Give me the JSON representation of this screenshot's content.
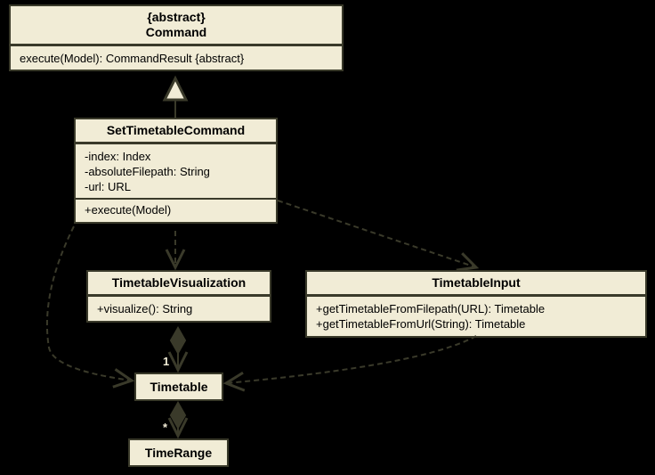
{
  "classes": {
    "command": {
      "stereotype": "{abstract}",
      "name": "Command",
      "method": "execute(Model): CommandResult {abstract}"
    },
    "setTimetableCommand": {
      "name": "SetTimetableCommand",
      "attr1": "-index: Index",
      "attr2": "-absoluteFilepath: String",
      "attr3": "-url: URL",
      "method": "+execute(Model)"
    },
    "timetableVisualization": {
      "name": "TimetableVisualization",
      "method": "+visualize(): String"
    },
    "timetableInput": {
      "name": "TimetableInput",
      "method1": "+getTimetableFromFilepath(URL): Timetable",
      "method2": "+getTimetableFromUrl(String): Timetable"
    },
    "timetable": {
      "name": "Timetable"
    },
    "timeRange": {
      "name": "TimeRange"
    }
  },
  "multiplicities": {
    "one": "1",
    "many": "*"
  },
  "chart_data": {
    "type": "uml-class-diagram",
    "classes": [
      {
        "name": "Command",
        "abstract": true,
        "methods": [
          "execute(Model): CommandResult {abstract}"
        ]
      },
      {
        "name": "SetTimetableCommand",
        "attributes": [
          "-index: Index",
          "-absoluteFilepath: String",
          "-url: URL"
        ],
        "methods": [
          "+execute(Model)"
        ]
      },
      {
        "name": "TimetableVisualization",
        "methods": [
          "+visualize(): String"
        ]
      },
      {
        "name": "TimetableInput",
        "methods": [
          "+getTimetableFromFilepath(URL): Timetable",
          "+getTimetableFromUrl(String): Timetable"
        ]
      },
      {
        "name": "Timetable"
      },
      {
        "name": "TimeRange"
      }
    ],
    "relationships": [
      {
        "from": "SetTimetableCommand",
        "to": "Command",
        "type": "generalization"
      },
      {
        "from": "SetTimetableCommand",
        "to": "TimetableVisualization",
        "type": "dependency"
      },
      {
        "from": "SetTimetableCommand",
        "to": "TimetableInput",
        "type": "dependency"
      },
      {
        "from": "SetTimetableCommand",
        "to": "Timetable",
        "type": "dependency"
      },
      {
        "from": "TimetableInput",
        "to": "Timetable",
        "type": "dependency"
      },
      {
        "from": "TimetableVisualization",
        "to": "Timetable",
        "type": "composition",
        "multiplicity_to": "1"
      },
      {
        "from": "Timetable",
        "to": "TimeRange",
        "type": "composition",
        "multiplicity_to": "*"
      }
    ]
  }
}
